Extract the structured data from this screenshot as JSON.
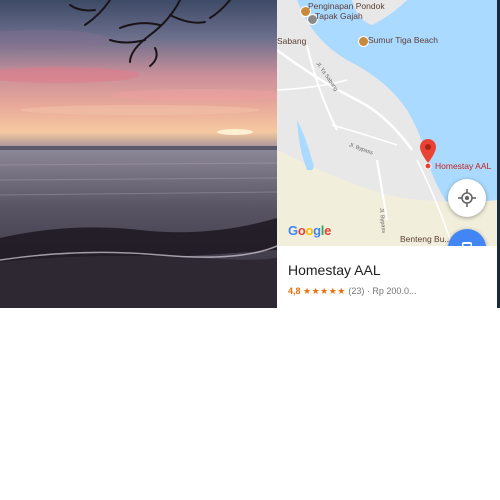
{
  "map": {
    "pois": [
      {
        "name": "Penginapan Pondok",
        "line2": "Tapak Gajah"
      },
      {
        "name": "Sumur Tiga Beach"
      },
      {
        "name": "Sabang"
      },
      {
        "name": "Benteng Bu..."
      }
    ],
    "roads": [
      "Jl. Ya Sabang",
      "Jl. Bypass",
      "Jl. Bypass"
    ],
    "marker_label": "Homestay AAL",
    "google_logo": [
      "G",
      "o",
      "o",
      "g",
      "l",
      "e"
    ]
  },
  "place": {
    "name": "Homestay AAL",
    "rating": "4,8",
    "stars": "★★★★★",
    "reviews": "(23)",
    "price": "· Rp 200.0..."
  },
  "colors": {
    "accent": "#4285f4",
    "marker": "#ea4335",
    "stars": "#e8710a",
    "water": "#aadaff",
    "land": "#e8e8e8"
  },
  "icons": {
    "my_location": "crosshair-icon",
    "transit": "bus-icon",
    "marker": "map-pin-icon"
  }
}
